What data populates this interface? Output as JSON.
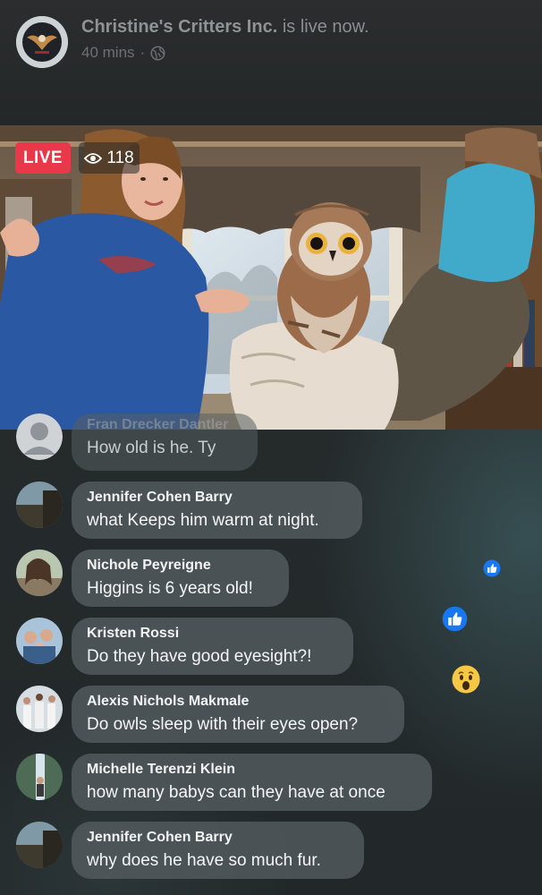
{
  "header": {
    "page_name": "Christine's Critters Inc.",
    "status_text": "is live now.",
    "time_ago": "40 mins",
    "separator": "·",
    "privacy_icon": "globe-icon"
  },
  "video": {
    "live_label": "LIVE",
    "viewer_count": "118",
    "viewer_icon": "eye-icon"
  },
  "comments": [
    {
      "name": "Fran Drecker Dantler",
      "text": "How old is he. Ty"
    },
    {
      "name": "Jennifer Cohen Barry",
      "text": "what Keeps him warm at night."
    },
    {
      "name": "Nichole Peyreigne",
      "text": "Higgins is 6 years old!"
    },
    {
      "name": "Kristen Rossi",
      "text": "Do they have good eyesight?!"
    },
    {
      "name": "Alexis Nichols Makmale",
      "text": "Do owls sleep with their eyes open?"
    },
    {
      "name": "Michelle Terenzi Klein",
      "text": "how many babys can they have at once"
    },
    {
      "name": "Jennifer Cohen Barry",
      "text": "why does he have so much fur."
    }
  ],
  "reactions": [
    "like-icon",
    "like-icon",
    "wow-icon"
  ],
  "colors": {
    "live_red": "#e8384a",
    "like_blue": "#1877f2",
    "wow_yellow": "#f7c844"
  }
}
